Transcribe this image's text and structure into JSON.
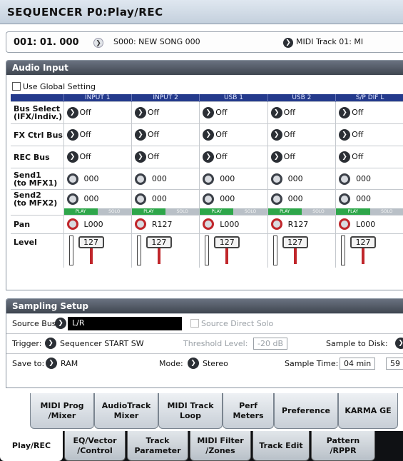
{
  "title": "SEQUENCER P0:Play/REC",
  "location": {
    "position": "001: 01. 000",
    "song": "S000: NEW SONG 000",
    "track": "MIDI Track 01: MI"
  },
  "audio_input": {
    "header": "Audio Input",
    "use_global_setting": "Use Global Setting",
    "columns": [
      "INPUT 1",
      "INPUT 2",
      "USB 1",
      "USB 2",
      "S/P DIF L"
    ],
    "row_labels": {
      "bus_select": [
        "Bus Select",
        "(IFX/Indiv.)"
      ],
      "fx_ctrl_bus": "FX Ctrl Bus",
      "rec_bus": "REC Bus",
      "send1": [
        "Send1",
        "(to MFX1)"
      ],
      "send2": [
        "Send2",
        "(to MFX2)"
      ],
      "pan": "Pan",
      "level": "Level"
    },
    "bus_select": [
      "Off",
      "Off",
      "Off",
      "Off",
      "Off"
    ],
    "fx_ctrl_bus": [
      "Off",
      "Off",
      "Off",
      "Off",
      "Off"
    ],
    "rec_bus": [
      "Off",
      "Off",
      "Off",
      "Off",
      "Off"
    ],
    "send1": [
      "000",
      "000",
      "000",
      "000",
      "000"
    ],
    "send2": [
      "000",
      "000",
      "000",
      "000",
      "000"
    ],
    "play_label": "PLAY",
    "solo_label": "SOLO",
    "pan": [
      "L000",
      "R127",
      "L000",
      "R127",
      "L000"
    ],
    "level": [
      "127",
      "127",
      "127",
      "127",
      "127"
    ]
  },
  "sampling_setup": {
    "header": "Sampling Setup",
    "source_bus_label": "Source Bus:",
    "source_bus_value": "L/R",
    "source_direct_solo": "Source Direct Solo",
    "trigger_label": "Trigger:",
    "trigger_value": "Sequencer START SW",
    "threshold_label": "Threshold Level:",
    "threshold_value": "-20 dB",
    "sample_to_disk_label": "Sample to Disk:",
    "save_to_label": "Save to:",
    "save_to_value": "RAM",
    "mode_label": "Mode:",
    "mode_value": "Stereo",
    "sample_time_label": "Sample Time:",
    "sample_time_min": "04 min",
    "sample_time_sec": "59"
  },
  "upper_tabs": [
    [
      "MIDI Prog",
      "/Mixer"
    ],
    [
      "AudioTrack",
      "Mixer"
    ],
    [
      "MIDI Track",
      "Loop"
    ],
    [
      "Perf",
      "Meters"
    ],
    [
      "Preference"
    ],
    [
      "KARMA GE"
    ]
  ],
  "lower_tabs": [
    [
      "Play/REC"
    ],
    [
      "EQ/Vector",
      "/Control"
    ],
    [
      "Track",
      "Parameter"
    ],
    [
      "MIDI Filter",
      "/Zones"
    ],
    [
      "Track Edit"
    ],
    [
      "Pattern",
      "/RPPR"
    ]
  ],
  "colors": {
    "header_blue": "#243a8c",
    "play_green": "#2ea64a",
    "accent_red": "#c0262b"
  }
}
